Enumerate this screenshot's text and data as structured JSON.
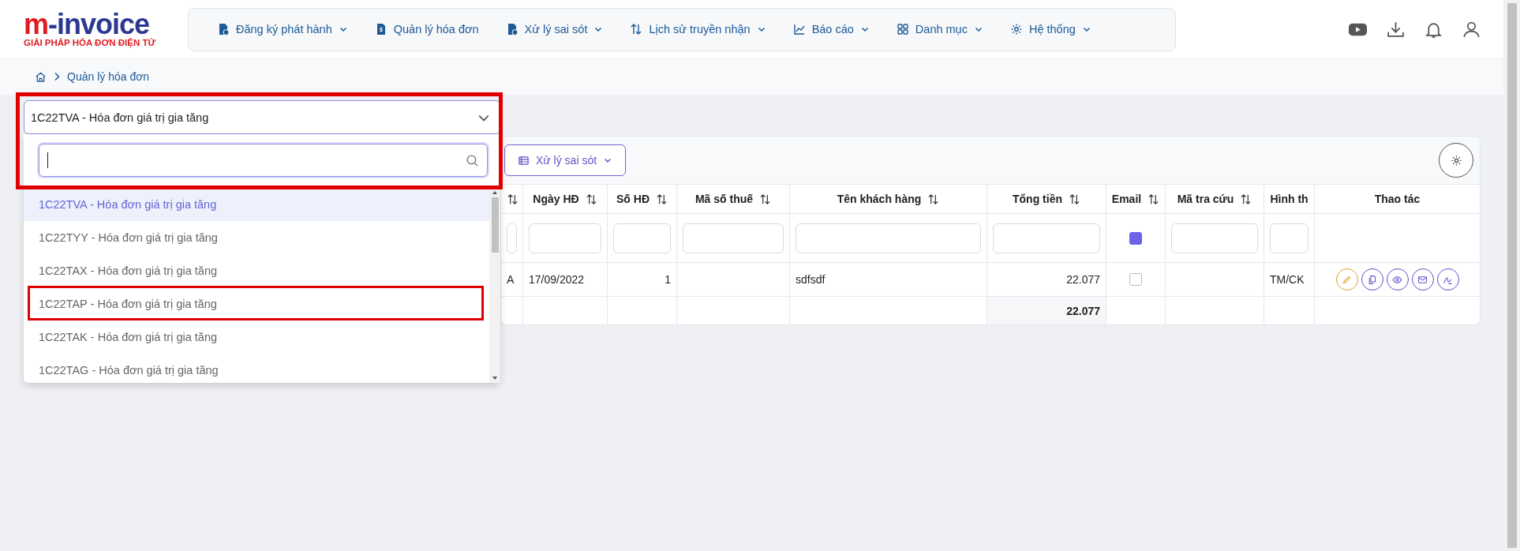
{
  "logo": {
    "mark": "m",
    "name": "-invoice",
    "tagline": "GIẢI PHÁP HÓA ĐƠN ĐIỆN TỬ"
  },
  "nav": [
    {
      "label": "Đăng ký phát hành",
      "dropdown": true
    },
    {
      "label": "Quản lý hóa đơn",
      "dropdown": false
    },
    {
      "label": "Xử lý sai sót",
      "dropdown": true
    },
    {
      "label": "Lịch sử truyền nhận",
      "dropdown": true
    },
    {
      "label": "Báo cáo",
      "dropdown": true
    },
    {
      "label": "Danh mục",
      "dropdown": true
    },
    {
      "label": "Hệ thống",
      "dropdown": true
    }
  ],
  "breadcrumb": [
    "Quản lý hóa đơn"
  ],
  "series_select": {
    "value": "1C22TVA - Hóa đơn giá trị gia tăng",
    "expanded": true,
    "marked": true
  },
  "options": [
    {
      "label": "1C22TVA - Hóa đơn giá trị gia tăng",
      "selected": true,
      "marked": false
    },
    {
      "label": "1C22TYY - Hóa đơn giá trị gia tăng",
      "selected": false,
      "marked": false
    },
    {
      "label": "1C22TAX - Hóa đơn giá trị gia tăng",
      "selected": false,
      "marked": false
    },
    {
      "label": "1C22TAP - Hóa đơn giá trị gia tăng",
      "selected": false,
      "marked": true
    },
    {
      "label": "1C22TAK - Hóa đơn giá trị gia tăng",
      "selected": false,
      "marked": false
    },
    {
      "label": "1C22TAG - Hóa đơn giá trị gia tăng",
      "selected": false,
      "marked": false
    }
  ],
  "toolbar": {
    "button": "Xử lý sai sót"
  },
  "table": {
    "columns": [
      {
        "kind": "text",
        "sortable": true
      },
      {
        "label": "Ngày HĐ",
        "kind": "text",
        "sortable": true
      },
      {
        "label": "Số HĐ",
        "kind": "number",
        "sortable": true
      },
      {
        "label": "Mã số thuế",
        "kind": "text",
        "sortable": true
      },
      {
        "label": "Tên khách hàng",
        "kind": "text",
        "sortable": true
      },
      {
        "label": "Tổng tiền",
        "kind": "number",
        "sortable": true,
        "total": "22.077"
      },
      {
        "label": "Email",
        "kind": "check",
        "sortable": true,
        "filter_checked": true
      },
      {
        "label": "Mã tra cứu",
        "kind": "text",
        "sortable": true
      },
      {
        "label": "Hình th",
        "kind": "text",
        "sortable": false
      },
      {
        "label": "Thao tác",
        "kind": "actions",
        "sortable": false
      }
    ],
    "rows": [
      {
        "cells": [
          "A",
          "17/09/2022",
          "1",
          null,
          "sdfsdf",
          "22.077",
          null,
          null,
          "TM/CK",
          null
        ],
        "email": false
      }
    ]
  }
}
